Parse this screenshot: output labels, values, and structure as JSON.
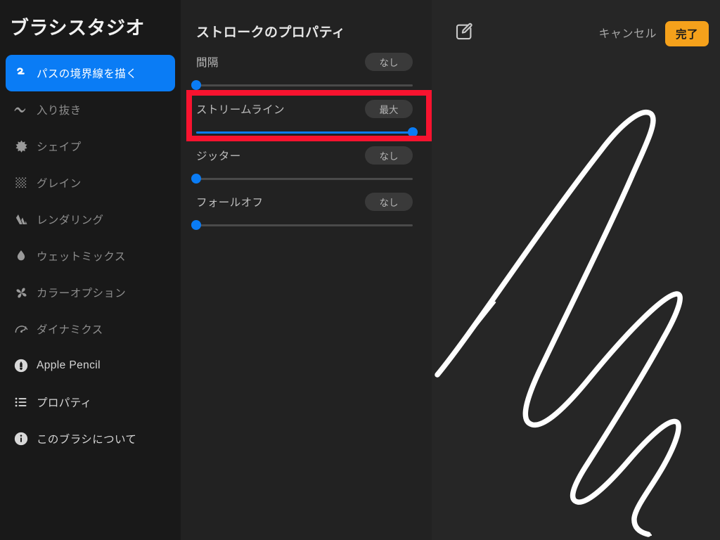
{
  "sidebar": {
    "title": "ブラシスタジオ",
    "items": [
      {
        "label": "パスの境界線を描く",
        "icon": "stroke-path-icon",
        "selected": true,
        "bright": false
      },
      {
        "label": "入り抜き",
        "icon": "taper-wave-icon",
        "selected": false,
        "bright": false
      },
      {
        "label": "シェイプ",
        "icon": "shape-star-icon",
        "selected": false,
        "bright": false
      },
      {
        "label": "グレイン",
        "icon": "grain-dots-icon",
        "selected": false,
        "bright": false
      },
      {
        "label": "レンダリング",
        "icon": "rendering-mountains-icon",
        "selected": false,
        "bright": false
      },
      {
        "label": "ウェットミックス",
        "icon": "droplet-icon",
        "selected": false,
        "bright": false
      },
      {
        "label": "カラーオプション",
        "icon": "pinwheel-icon",
        "selected": false,
        "bright": false
      },
      {
        "label": "ダイナミクス",
        "icon": "gauge-icon",
        "selected": false,
        "bright": false
      },
      {
        "label": "Apple Pencil",
        "icon": "apple-pencil-icon",
        "selected": false,
        "bright": true
      },
      {
        "label": "プロパティ",
        "icon": "list-icon",
        "selected": false,
        "bright": true
      },
      {
        "label": "このブラシについて",
        "icon": "info-circle-icon",
        "selected": false,
        "bright": true
      }
    ]
  },
  "properties": {
    "title": "ストロークのプロパティ",
    "rows": [
      {
        "name": "間隔",
        "value_label": "なし",
        "percent": 0,
        "highlighted": false
      },
      {
        "name": "ストリームライン",
        "value_label": "最大",
        "percent": 100,
        "highlighted": true
      },
      {
        "name": "ジッター",
        "value_label": "なし",
        "percent": 0,
        "highlighted": false
      },
      {
        "name": "フォールオフ",
        "value_label": "なし",
        "percent": 0,
        "highlighted": false
      }
    ]
  },
  "topbar": {
    "compose_icon": "compose-edit-icon",
    "cancel_label": "キャンセル",
    "done_label": "完了"
  },
  "colors": {
    "accent_blue": "#0a7cf5",
    "done_orange": "#f5a11b",
    "highlight_red": "#f8132f",
    "sidebar_bg": "#191919",
    "props_bg": "#222222",
    "canvas_bg": "#262626",
    "stroke_white": "#ffffff"
  },
  "preview": {
    "stroke_name": "brush-stroke-preview"
  }
}
